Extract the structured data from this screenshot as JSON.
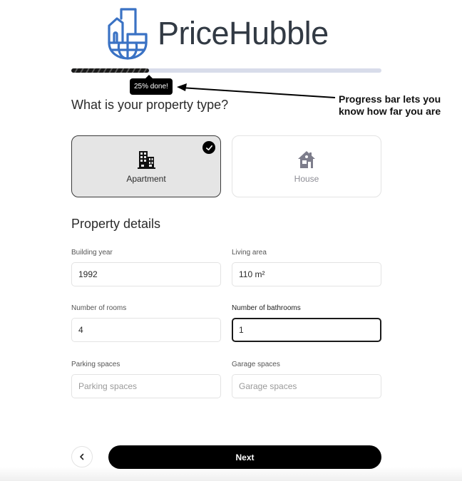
{
  "brand": {
    "name": "PriceHubble",
    "logo_icon": "building-globe-shield-icon",
    "color": "#3a72c4",
    "text_color": "#323a44"
  },
  "progress": {
    "percent": 25,
    "tooltip": "25% done!"
  },
  "annotation": {
    "text_line1": "Progress bar lets you",
    "text_line2": "know how far you are"
  },
  "property_type": {
    "heading": "What is your property type?",
    "options": [
      {
        "label": "Apartment",
        "icon": "apartment-building-icon",
        "selected": true
      },
      {
        "label": "House",
        "icon": "house-icon",
        "selected": false
      }
    ]
  },
  "details": {
    "heading": "Property details",
    "fields": [
      {
        "label": "Building year",
        "value": "1992",
        "placeholder": ""
      },
      {
        "label": "Living area",
        "value": "110 m²",
        "placeholder": ""
      },
      {
        "label": "Number of rooms",
        "value": "4",
        "placeholder": ""
      },
      {
        "label": "Number of bathrooms",
        "value": "1",
        "placeholder": "",
        "focused": true
      },
      {
        "label": "Parking spaces",
        "value": "",
        "placeholder": "Parking spaces"
      },
      {
        "label": "Garage spaces",
        "value": "",
        "placeholder": "Garage spaces"
      }
    ]
  },
  "nav": {
    "back_icon": "chevron-left-icon",
    "next_label": "Next"
  }
}
